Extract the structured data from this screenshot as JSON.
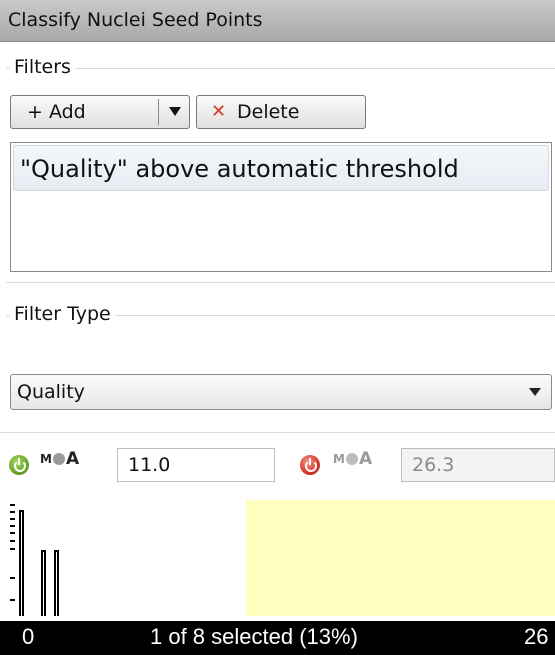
{
  "panel": {
    "title": "Classify Nuclei Seed Points"
  },
  "filters": {
    "group_label": "Filters",
    "add_label": "+ Add",
    "delete_label": "Delete",
    "list_items": [
      "\"Quality\" above automatic threshold"
    ]
  },
  "filter_type": {
    "group_label": "Filter Type",
    "selected": "Quality"
  },
  "threshold": {
    "lower_value": "11.0",
    "upper_value": "26.3",
    "mode_letters": {
      "m": "M",
      "a": "A"
    }
  },
  "histogram": {
    "min_label": "0",
    "max_label": "26",
    "status_text": "1 of 8 selected (13%)"
  },
  "colors": {
    "power_on": "#6aa52a",
    "power_off": "#d9342b",
    "delete_x": "#d23a2a",
    "selected_band": "#ffffc0"
  }
}
